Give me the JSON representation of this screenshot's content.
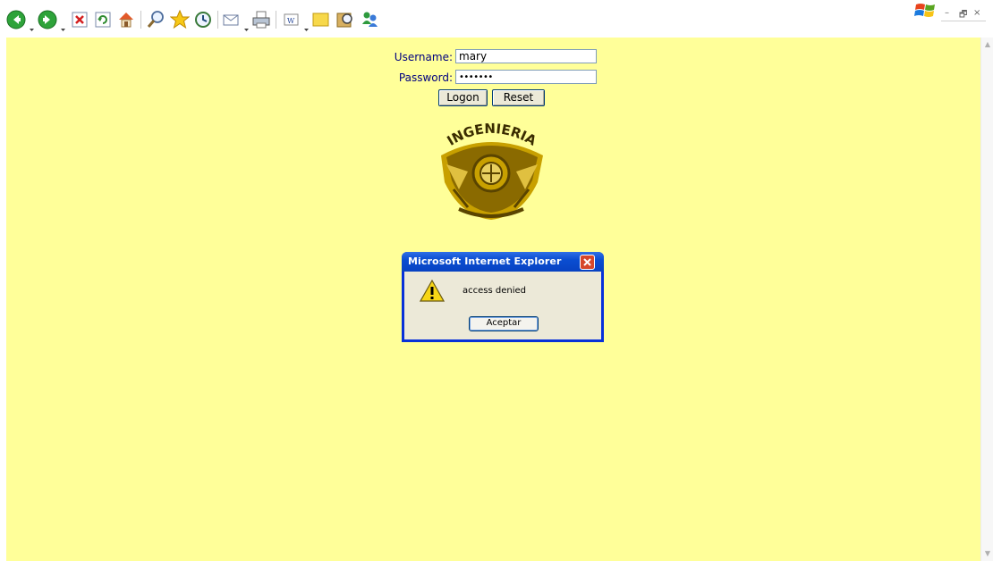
{
  "toolbar": {
    "icons": [
      "back-icon",
      "forward-icon",
      "stop-icon",
      "refresh-icon",
      "home-icon",
      "search-icon",
      "favorites-icon",
      "history-icon",
      "mail-icon",
      "print-icon",
      "edit-icon",
      "discuss-icon",
      "research-icon",
      "messenger-icon"
    ]
  },
  "login": {
    "username_label": "Username:",
    "username_value": "mary",
    "password_label": "Password:",
    "password_value": "•••••••",
    "logon_label": "Logon",
    "reset_label": "Reset"
  },
  "logo": {
    "text": "INGENIERIA",
    "color": "#c8a000"
  },
  "dialog": {
    "title": "Microsoft Internet Explorer",
    "message": "access denied",
    "ok_label": "Aceptar",
    "icon": "warning-icon"
  },
  "window_controls": {
    "minimize": "–",
    "restore": "🗗",
    "close": "×"
  },
  "colors": {
    "page_background": "#ffff99",
    "label_text": "#000080",
    "dialog_title": "#0a4ed1"
  }
}
